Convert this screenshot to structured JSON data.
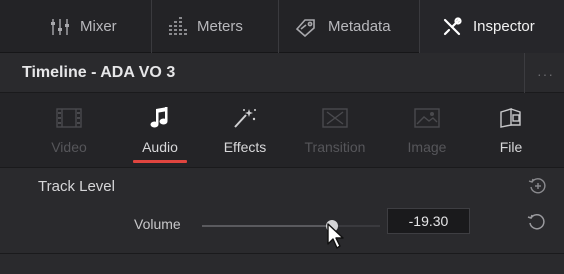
{
  "toolbar": {
    "mixer_label": "Mixer",
    "meters_label": "Meters",
    "metadata_label": "Metadata",
    "inspector_label": "Inspector"
  },
  "panel": {
    "title": "Timeline - ADA VO 3",
    "more": "···"
  },
  "tabs": [
    {
      "label": "Video",
      "icon": "video-icon",
      "enabled": false
    },
    {
      "label": "Audio",
      "icon": "music-note-icon",
      "enabled": true,
      "active": true
    },
    {
      "label": "Effects",
      "icon": "magic-wand-icon",
      "enabled": true
    },
    {
      "label": "Transition",
      "icon": "transition-icon",
      "enabled": false
    },
    {
      "label": "Image",
      "icon": "image-icon",
      "enabled": false
    },
    {
      "label": "File",
      "icon": "file-icon",
      "enabled": true
    }
  ],
  "track_level": {
    "title": "Track Level",
    "volume_label": "Volume",
    "volume_value": "-19.30",
    "volume_slider_fraction": 0.73
  },
  "colors": {
    "accent": "#e0453f",
    "background": "#1c1c1e"
  }
}
